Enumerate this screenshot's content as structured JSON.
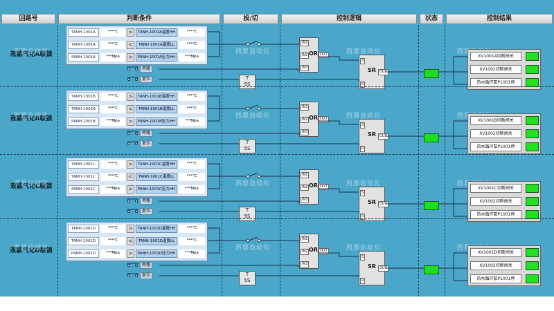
{
  "headers": [
    "回路号",
    "判断条件",
    "投/切",
    "控制逻辑",
    "状态",
    "控制结果"
  ],
  "watermark": "西恩自动化",
  "colors": {
    "board": "#4aa7c9",
    "lamp": "#1adf1a",
    "limit_cell": "#b4d2ee"
  },
  "groups": [
    {
      "label": "液氯气化A联锁",
      "conditions": [
        {
          "tag": "TANH-1001A",
          "value": "***℃",
          "op": ">",
          "limit": "TANH-1001A温度HH",
          "limit_value": "***℃"
        },
        {
          "tag": "TANH-1001A",
          "value": "***℃",
          "op": "<",
          "limit": "TANH-1001A温度LL",
          "limit_value": "***℃"
        },
        {
          "tag": "PANH-1001A",
          "value": "***Mpa",
          "op": ">",
          "limit": "PANH-1001A压力HH",
          "limit_value": "***Mpa"
        }
      ],
      "bypass_label": "旁路",
      "reset_label": "复位",
      "timer": {
        "line1": "T",
        "line2": "5S"
      },
      "or_block": {
        "name": "OR",
        "pins": [
          "IN1",
          "IN2",
          "IN3"
        ],
        "out": "OUT"
      },
      "sr_block": {
        "name": "SR",
        "pins": [
          "S",
          "R"
        ],
        "out": "OUT"
      },
      "results": [
        "XV1001A切断阀关",
        "XV1002切断阀关",
        "热水循环泵P1001停"
      ]
    },
    {
      "label": "液氯气化B联锁",
      "conditions": [
        {
          "tag": "TANH-1001B",
          "value": "***℃",
          "op": ">",
          "limit": "TANH-1001B温度HH",
          "limit_value": "***℃"
        },
        {
          "tag": "TANH-1001B",
          "value": "***℃",
          "op": "<",
          "limit": "TANH-1001B温度LL",
          "limit_value": "***℃"
        },
        {
          "tag": "PANH-1001B",
          "value": "***Mpa",
          "op": ">",
          "limit": "PANH-1001B压力HH",
          "limit_value": "***Mpa"
        }
      ],
      "bypass_label": "旁路",
      "reset_label": "复位",
      "timer": {
        "line1": "T",
        "line2": "5S"
      },
      "or_block": {
        "name": "OR",
        "pins": [
          "IN1",
          "IN2",
          "IN3"
        ],
        "out": "OUT"
      },
      "sr_block": {
        "name": "SR",
        "pins": [
          "S",
          "R"
        ],
        "out": "OUT"
      },
      "results": [
        "XV1001B切断阀关",
        "XV1002切断阀关",
        "热水循环泵P1001停"
      ]
    },
    {
      "label": "液氯气化C联锁",
      "conditions": [
        {
          "tag": "TANH-1001C",
          "value": "***℃",
          "op": ">",
          "limit": "TANH-1001C温度HH",
          "limit_value": "***℃"
        },
        {
          "tag": "TANH-1001C",
          "value": "***℃",
          "op": "<",
          "limit": "TANH-1001C温度LL",
          "limit_value": "***℃"
        },
        {
          "tag": "PANH-1001C",
          "value": "***Mpa",
          "op": ">",
          "limit": "PANH-1001C压力HH",
          "limit_value": "***Mpa"
        }
      ],
      "bypass_label": "旁路",
      "reset_label": "复位",
      "timer": {
        "line1": "T",
        "line2": "5S"
      },
      "or_block": {
        "name": "OR",
        "pins": [
          "IN1",
          "IN2",
          "IN3"
        ],
        "out": "OUT"
      },
      "sr_block": {
        "name": "SR",
        "pins": [
          "S",
          "R"
        ],
        "out": "OUT"
      },
      "results": [
        "XV1001C切断阀关",
        "XV1002切断阀关",
        "热水循环泵P1001停"
      ]
    },
    {
      "label": "液氯气化D联锁",
      "conditions": [
        {
          "tag": "TANH-1001D",
          "value": "***℃",
          "op": ">",
          "limit": "TANH-1001D温度HH",
          "limit_value": "***℃"
        },
        {
          "tag": "TANH-1001D",
          "value": "***℃",
          "op": "<",
          "limit": "TANH-1001D温度LL",
          "limit_value": "***℃"
        },
        {
          "tag": "PANH-1001D",
          "value": "***Mpa",
          "op": ">",
          "limit": "PANH-1001D压力HH",
          "limit_value": "***Mpa"
        }
      ],
      "bypass_label": "旁路",
      "reset_label": "复位",
      "timer": {
        "line1": "T",
        "line2": "5S"
      },
      "or_block": {
        "name": "OR",
        "pins": [
          "IN1",
          "IN2",
          "IN3"
        ],
        "out": "OUT"
      },
      "sr_block": {
        "name": "SR",
        "pins": [
          "S",
          "R"
        ],
        "out": "OUT"
      },
      "results": [
        "XV1001D切断阀关",
        "XV1002切断阀关",
        "热水循环泵P1001停"
      ]
    }
  ]
}
